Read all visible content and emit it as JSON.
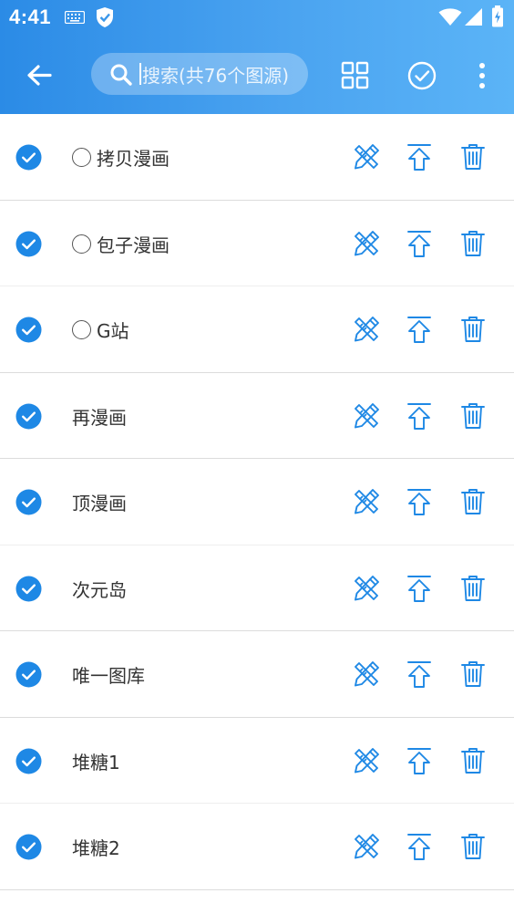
{
  "status_bar": {
    "time": "4:41",
    "icons": [
      "keyboard-icon",
      "shield-check-icon",
      "wifi-icon",
      "signal-icon",
      "battery-charging-icon"
    ]
  },
  "toolbar": {
    "back_icon": "arrow-left-icon",
    "search_placeholder": "搜索(共76个图源)",
    "actions": [
      "grid-view-icon",
      "select-all-check-icon",
      "more-vert-icon"
    ]
  },
  "colors": {
    "accent": "#1e88e5",
    "appbar_start": "#2b8be6",
    "appbar_end": "#5bb4f7",
    "divider": "#dcdcdc"
  },
  "sources": [
    {
      "name": "拷贝漫画",
      "checked": true,
      "radio": true
    },
    {
      "name": "包子漫画",
      "checked": true,
      "radio": true
    },
    {
      "name": "G站",
      "checked": true,
      "radio": true
    },
    {
      "name": "再漫画",
      "checked": true,
      "radio": false
    },
    {
      "name": "顶漫画",
      "checked": true,
      "radio": false
    },
    {
      "name": "次元岛",
      "checked": true,
      "radio": false
    },
    {
      "name": "唯一图库",
      "checked": true,
      "radio": false
    },
    {
      "name": "堆糖1",
      "checked": true,
      "radio": false
    },
    {
      "name": "堆糖2",
      "checked": true,
      "radio": false
    }
  ],
  "row_actions": [
    "edit-icon",
    "move-top-icon",
    "delete-icon"
  ]
}
